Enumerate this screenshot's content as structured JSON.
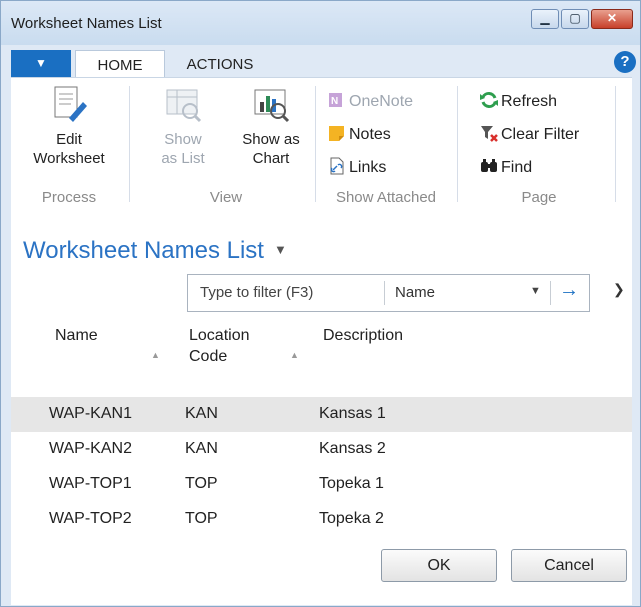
{
  "window": {
    "title": "Worksheet Names List"
  },
  "tabs": {
    "home": "HOME",
    "actions": "ACTIONS"
  },
  "ribbon": {
    "process": {
      "label": "Process",
      "edit_worksheet": [
        "Edit",
        "Worksheet"
      ]
    },
    "view": {
      "label": "View",
      "show_as_list": [
        "Show",
        "as List"
      ],
      "show_as_chart": [
        "Show as",
        "Chart"
      ]
    },
    "show_attached": {
      "label": "Show Attached",
      "onenote": "OneNote",
      "notes": "Notes",
      "links": "Links"
    },
    "page": {
      "label": "Page",
      "refresh": "Refresh",
      "clear_filter": "Clear Filter",
      "find": "Find"
    }
  },
  "page": {
    "title": "Worksheet Names List",
    "filter": {
      "placeholder": "Type to filter (F3)",
      "field": "Name"
    },
    "columns": {
      "name": "Name",
      "location_code": [
        "Location",
        "Code"
      ],
      "description": "Description"
    },
    "rows": [
      {
        "name": "WAP-KAN1",
        "location_code": "KAN",
        "description": "Kansas 1"
      },
      {
        "name": "WAP-KAN2",
        "location_code": "KAN",
        "description": "Kansas 2"
      },
      {
        "name": "WAP-TOP1",
        "location_code": "TOP",
        "description": "Topeka 1"
      },
      {
        "name": "WAP-TOP2",
        "location_code": "TOP",
        "description": "Topeka 2"
      }
    ]
  },
  "buttons": {
    "ok": "OK",
    "cancel": "Cancel"
  },
  "colors": {
    "accent": "#1a6fc2",
    "title_blue": "#2b73c4",
    "selected_row": "#e6e6e6",
    "disabled_text": "#9ea6b0"
  },
  "icons": [
    "chevron-down-icon",
    "minimize-icon",
    "maximize-icon",
    "close-icon",
    "help-icon",
    "edit-worksheet-icon",
    "show-as-list-icon",
    "show-as-chart-icon",
    "onenote-icon",
    "notes-icon",
    "links-icon",
    "refresh-icon",
    "clear-filter-icon",
    "find-icon",
    "arrow-right-icon",
    "sort-ascending-icon"
  ]
}
